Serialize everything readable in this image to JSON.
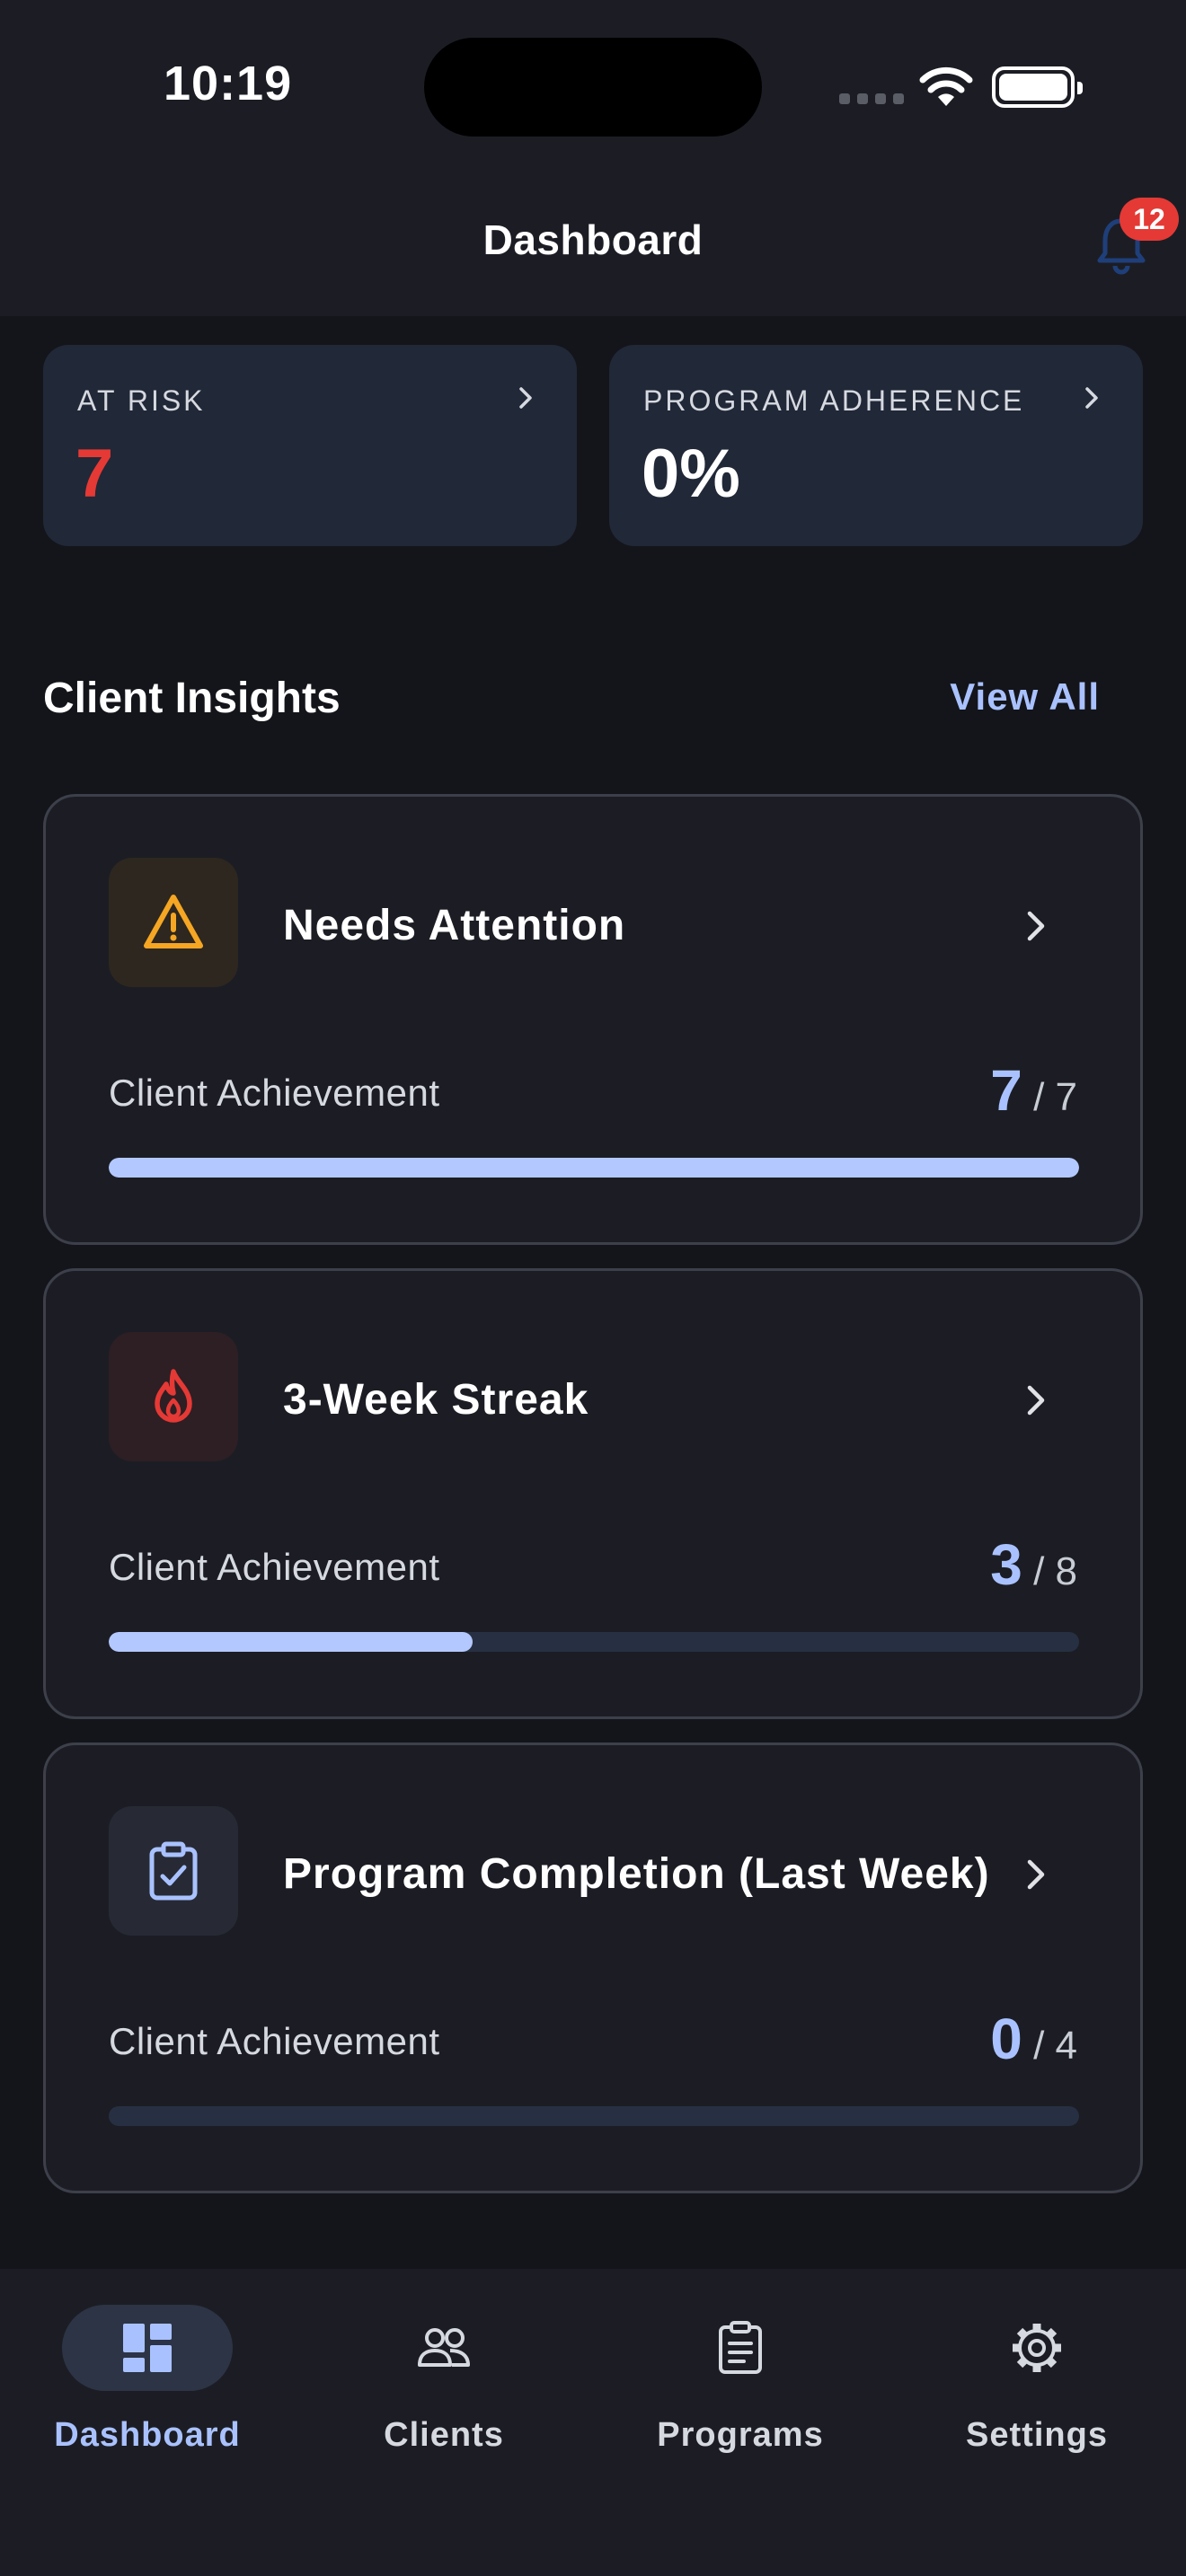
{
  "status_bar": {
    "time": "10:19"
  },
  "header": {
    "title": "Dashboard",
    "notification_count": "12"
  },
  "stats": [
    {
      "label": "AT RISK",
      "value": "7",
      "value_color": "#e53935"
    },
    {
      "label": "PROGRAM ADHERENCE",
      "value": "0%",
      "value_color": "#ffffff"
    }
  ],
  "insights": {
    "title": "Client Insights",
    "view_all": "View All",
    "cards": [
      {
        "title": "Needs Attention",
        "icon": "warning-icon",
        "achievement_label": "Client Achievement",
        "achieved": "7",
        "total": "/ 7",
        "progress": 1.0
      },
      {
        "title": "3-Week Streak",
        "icon": "flame-icon",
        "achievement_label": "Client Achievement",
        "achieved": "3",
        "total": "/ 8",
        "progress": 0.375
      },
      {
        "title": "Program Completion (Last Week)",
        "icon": "clipboard-check-icon",
        "achievement_label": "Client Achievement",
        "achieved": "0",
        "total": "/ 4",
        "progress": 0.0
      }
    ]
  },
  "nav": {
    "items": [
      {
        "label": "Dashboard",
        "icon": "dashboard-icon",
        "active": true
      },
      {
        "label": "Clients",
        "icon": "users-icon",
        "active": false
      },
      {
        "label": "Programs",
        "icon": "clipboard-icon",
        "active": false
      },
      {
        "label": "Settings",
        "icon": "gear-icon",
        "active": false
      }
    ]
  },
  "colors": {
    "accent": "#a9c2ff",
    "danger": "#e53935",
    "warning": "#f5a623"
  }
}
